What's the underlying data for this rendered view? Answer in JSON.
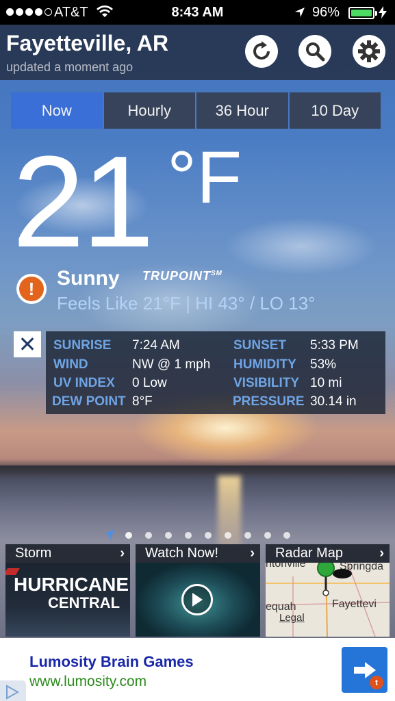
{
  "status_bar": {
    "carrier": "AT&T",
    "time": "8:43 AM",
    "battery": "96%"
  },
  "header": {
    "city": "Fayetteville, AR",
    "updated": "updated a moment ago"
  },
  "tabs": [
    {
      "label": "Now",
      "active": true
    },
    {
      "label": "Hourly",
      "active": false
    },
    {
      "label": "36 Hour",
      "active": false
    },
    {
      "label": "10 Day",
      "active": false
    }
  ],
  "current": {
    "temp": "21",
    "unit": "°F",
    "condition": "Sunny",
    "trupoint": "TRUPOINT",
    "trupoint_mark": "SM",
    "feels_like": "Feels Like 21°F | HI 43° / LO 13°"
  },
  "details": {
    "rows": [
      {
        "l1": "SUNRISE",
        "v1": "7:24 AM",
        "l2": "SUNSET",
        "v2": "5:33 PM"
      },
      {
        "l1": "WIND",
        "v1": "NW @ 1 mph",
        "l2": "HUMIDITY",
        "v2": "53%"
      },
      {
        "l1": "UV INDEX",
        "v1": "0 Low",
        "l2": "VISIBILITY",
        "v2": "10 mi"
      },
      {
        "l1": "DEW POINT",
        "v1": "8°F",
        "l2": "PRESSURE",
        "v2": "30.14 in"
      }
    ]
  },
  "cards": {
    "storm": {
      "title": "Storm",
      "line1": "HURRICANE",
      "line2": "CENTRAL"
    },
    "video": {
      "title": "Watch Now!"
    },
    "radar": {
      "title": "Radar Map",
      "towns": [
        "ntonville",
        "Springda",
        "equah",
        "Fayettevi"
      ],
      "legal": "Legal"
    }
  },
  "ad": {
    "title": "Lumosity Brain Games",
    "url": "www.lumosity.com",
    "badge": "t"
  },
  "colors": {
    "accent": "#3a6fd8",
    "label_blue": "#6fa5e6",
    "alert_orange": "#e3641c"
  }
}
